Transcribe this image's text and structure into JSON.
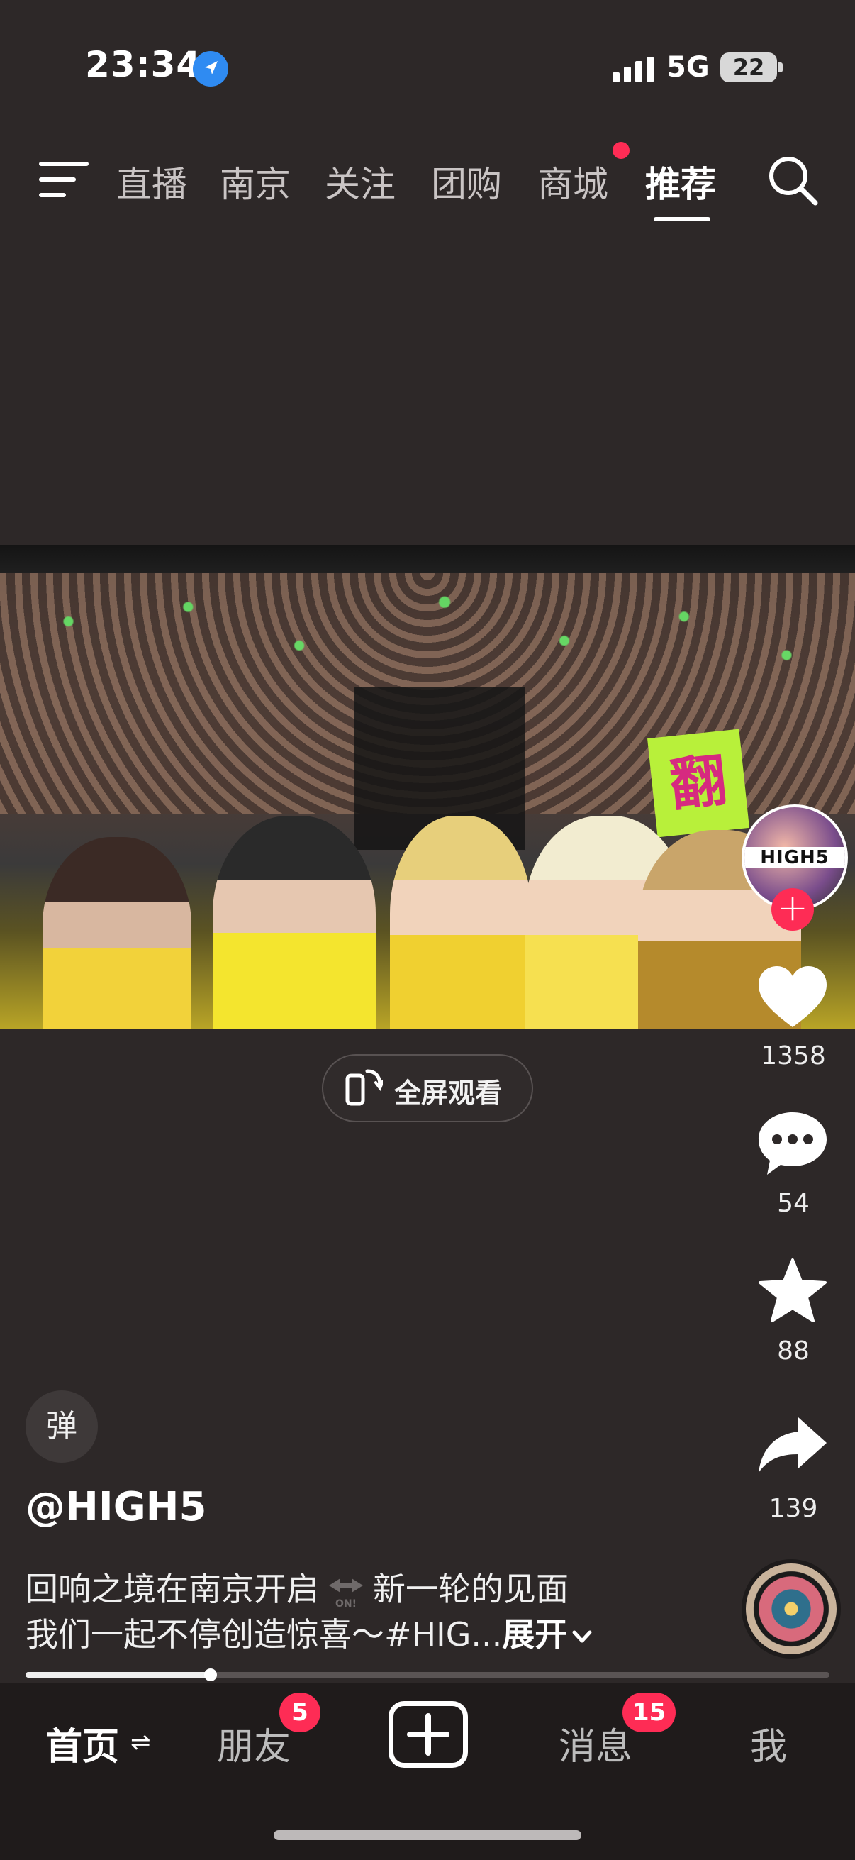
{
  "status_bar": {
    "time": "23:34",
    "network": "5G",
    "battery": "22"
  },
  "top_nav": {
    "tabs": [
      {
        "label": "直播",
        "active": false
      },
      {
        "label": "南京",
        "active": false
      },
      {
        "label": "关注",
        "active": false
      },
      {
        "label": "团购",
        "active": false
      },
      {
        "label": "商城",
        "active": false,
        "has_dot": true
      },
      {
        "label": "推荐",
        "active": true
      }
    ]
  },
  "video": {
    "fullscreen_label": "全屏观看",
    "author_avatar_text": "HIGH5",
    "sign_text": "翻"
  },
  "actions": {
    "likes": "1358",
    "comments": "54",
    "favorites": "88",
    "shares": "139"
  },
  "danmaku_label": "弹",
  "post": {
    "author": "@HIGH5",
    "caption_line1_a": "回响之境在南京开启",
    "caption_line1_b": "新一轮的见面",
    "caption_line2": "我们一起不停创造惊喜～#HIG...",
    "expand_label": "展开",
    "inline_icon_text": "ON!"
  },
  "progress": {
    "fraction": 0.23
  },
  "bottom_tabs": {
    "home": "首页",
    "friends": "朋友",
    "friends_badge": "5",
    "messages": "消息",
    "messages_badge": "15",
    "me": "我"
  },
  "colors": {
    "accent": "#fe2c55",
    "background": "#2d2828",
    "location_icon": "#2f8bf2"
  }
}
